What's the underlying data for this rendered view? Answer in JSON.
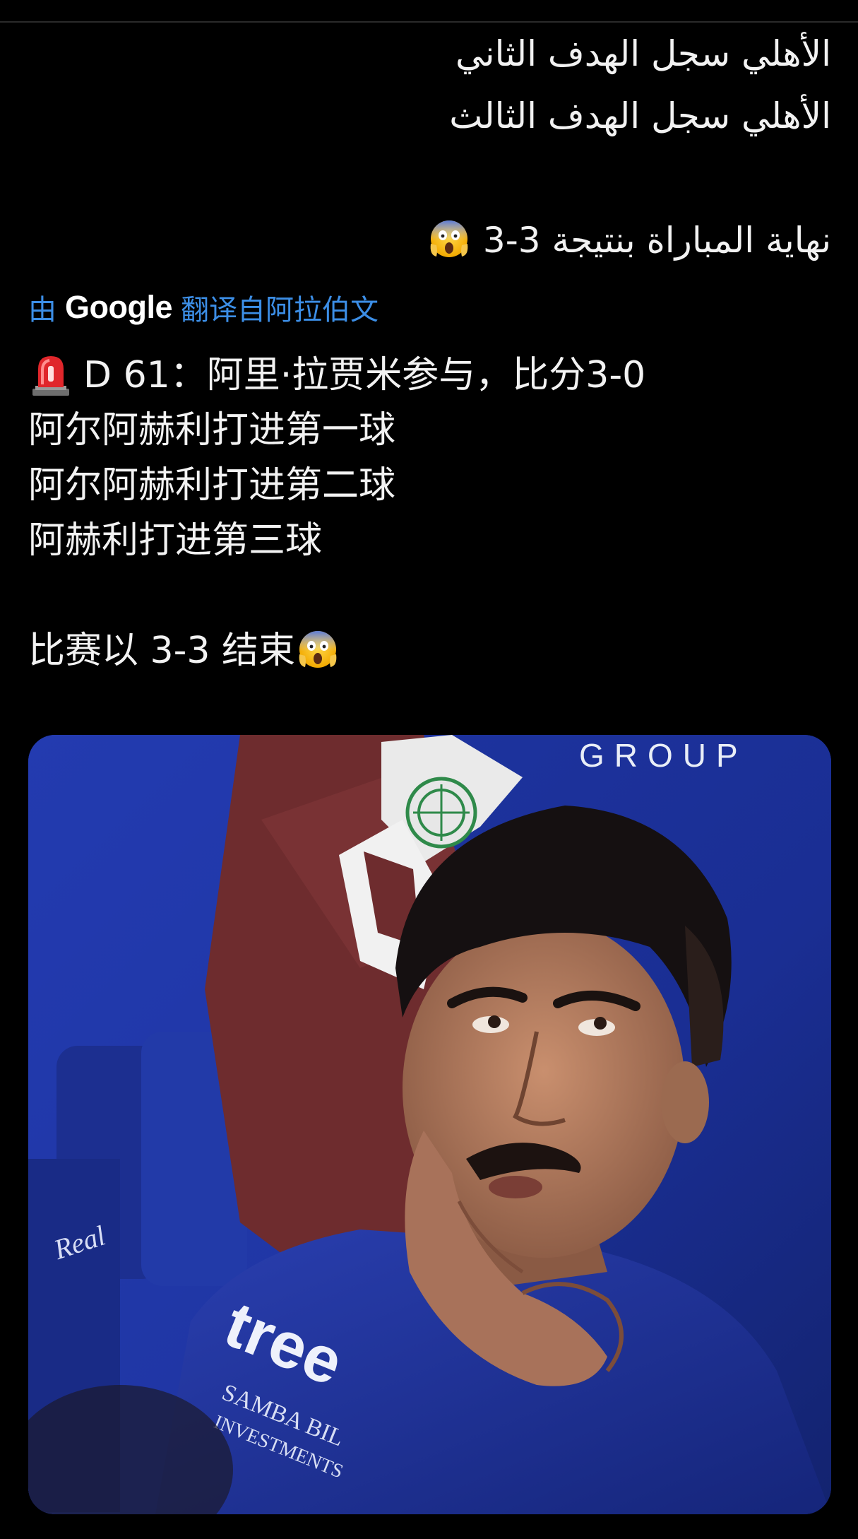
{
  "original_post": {
    "language": "ar",
    "lines": [
      "الأهلي سجل الهدف الثاني",
      "الأهلي سجل الهدف الثالث",
      "",
      "نهاية المباراة بنتيجة 3-3"
    ],
    "end_emoji": "face-screaming-in-fear"
  },
  "translation_bar": {
    "prefix": "由",
    "brand": "Google",
    "suffix": "翻译自阿拉伯文"
  },
  "translated_post": {
    "leading_emoji": "police-car-light",
    "lines": [
      "D 61：阿里·拉贾米参与，比分3-0",
      "阿尔阿赫利打进第一球",
      "阿尔阿赫利打进第二球",
      "阿赫利打进第三球",
      "",
      "比赛以 3-3 结束"
    ],
    "end_emoji": "face-screaming-in-fear"
  },
  "media": {
    "type": "photo",
    "description_tag": "player-photo",
    "visible_text": [
      "GROUP",
      "Real",
      "tree",
      "SAMBA BIL",
      "INVESTMENTS"
    ]
  },
  "colors": {
    "background": "#000000",
    "text": "#f2f2f2",
    "link": "#3c8ee6"
  }
}
